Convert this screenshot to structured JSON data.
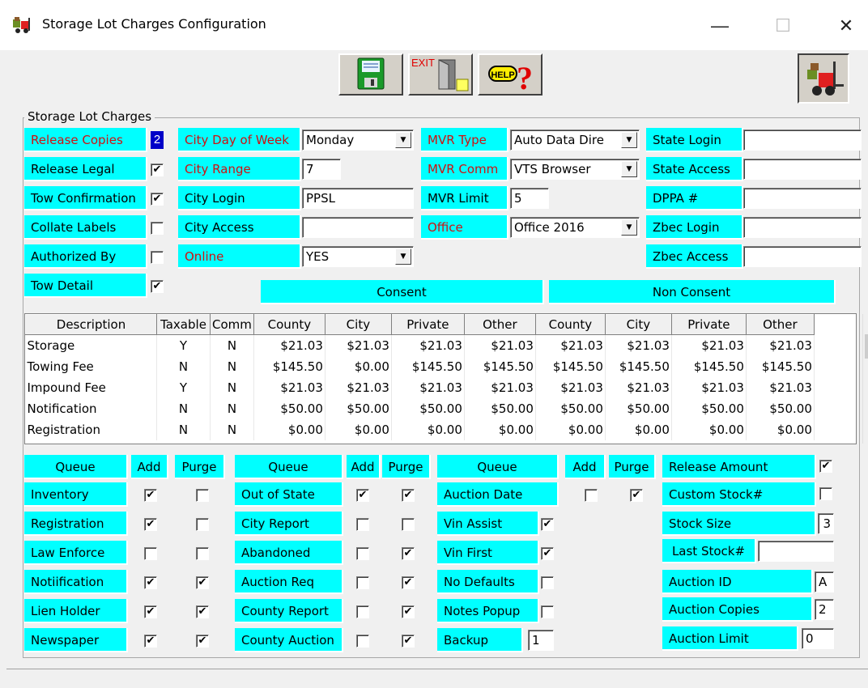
{
  "window": {
    "title": "Storage Lot Charges Configuration",
    "minimize_glyph": "—",
    "maximize_glyph": "☐",
    "close_glyph": "✕"
  },
  "toolbar": {
    "save_icon": "floppy-save-icon",
    "exit_label": "EXIT",
    "help_label": "HELP",
    "help_glyph": "?",
    "corner_icon": "forklift-icon"
  },
  "group_title": "Storage Lot Charges",
  "settings": {
    "release_copies": {
      "label": "Release Copies",
      "value": "2"
    },
    "release_legal": {
      "label": "Release Legal",
      "checked": true
    },
    "tow_confirmation": {
      "label": "Tow Confirmation",
      "checked": true
    },
    "collate_labels": {
      "label": "Collate Labels",
      "checked": false
    },
    "authorized_by": {
      "label": "Authorized By",
      "checked": false
    },
    "tow_detail": {
      "label": "Tow Detail",
      "checked": true
    },
    "city_day_of_week": {
      "label": "City Day of Week",
      "value": "Monday"
    },
    "city_range": {
      "label": "City Range",
      "value": "7"
    },
    "city_login": {
      "label": "City Login",
      "value": "PPSL"
    },
    "city_access": {
      "label": "City Access",
      "value": ""
    },
    "online": {
      "label": "Online",
      "value": "YES"
    },
    "mvr_type": {
      "label": "MVR Type",
      "value": "Auto Data Dire"
    },
    "mvr_comm": {
      "label": "MVR Comm",
      "value": "VTS Browser"
    },
    "mvr_limit": {
      "label": "MVR Limit",
      "value": "5"
    },
    "office": {
      "label": "Office",
      "value": "Office 2016"
    },
    "state_login": {
      "label": "State Login",
      "value": ""
    },
    "state_access": {
      "label": "State Access",
      "value": ""
    },
    "dppa": {
      "label": "DPPA #",
      "value": ""
    },
    "zbec_login": {
      "label": "Zbec Login",
      "value": ""
    },
    "zbec_access": {
      "label": "Zbec Access",
      "value": ""
    }
  },
  "consent_label": "Consent",
  "non_consent_label": "Non Consent",
  "grid": {
    "columns": [
      "Description",
      "Taxable",
      "Comm",
      "County",
      "City",
      "Private",
      "Other",
      "County",
      "City",
      "Private",
      "Other"
    ],
    "rows": [
      [
        "Storage",
        "Y",
        "N",
        "$21.03",
        "$21.03",
        "$21.03",
        "$21.03",
        "$21.03",
        "$21.03",
        "$21.03",
        "$21.03"
      ],
      [
        "Towing Fee",
        "N",
        "N",
        "$145.50",
        "$0.00",
        "$145.50",
        "$145.50",
        "$145.50",
        "$145.50",
        "$145.50",
        "$145.50"
      ],
      [
        "Impound Fee",
        "Y",
        "N",
        "$21.03",
        "$21.03",
        "$21.03",
        "$21.03",
        "$21.03",
        "$21.03",
        "$21.03",
        "$21.03"
      ],
      [
        "Notification",
        "N",
        "N",
        "$50.00",
        "$50.00",
        "$50.00",
        "$50.00",
        "$50.00",
        "$50.00",
        "$50.00",
        "$50.00"
      ],
      [
        "Registration",
        "N",
        "N",
        "$0.00",
        "$0.00",
        "$0.00",
        "$0.00",
        "$0.00",
        "$0.00",
        "$0.00",
        "$0.00"
      ]
    ]
  },
  "queue_header": {
    "queue": "Queue",
    "add": "Add",
    "purge": "Purge"
  },
  "queues1": [
    {
      "name": "Inventory",
      "add": true,
      "purge": false
    },
    {
      "name": "Registration",
      "add": true,
      "purge": false
    },
    {
      "name": "Law Enforce",
      "add": false,
      "purge": false
    },
    {
      "name": "Notiification",
      "add": true,
      "purge": true
    },
    {
      "name": "Lien Holder",
      "add": true,
      "purge": true
    },
    {
      "name": "Newspaper",
      "add": true,
      "purge": true
    }
  ],
  "queues2": [
    {
      "name": "Out of State",
      "add": true,
      "purge": true
    },
    {
      "name": "City Report",
      "add": false,
      "purge": false
    },
    {
      "name": "Abandoned",
      "add": false,
      "purge": true
    },
    {
      "name": "Auction Req",
      "add": false,
      "purge": true
    },
    {
      "name": "County Report",
      "add": false,
      "purge": true
    },
    {
      "name": "County Auction",
      "add": false,
      "purge": true
    }
  ],
  "queue3": {
    "name": "Auction Date",
    "add": false,
    "purge": true
  },
  "options3": [
    {
      "name": "Vin Assist",
      "checked": true
    },
    {
      "name": "Vin First",
      "checked": true
    },
    {
      "name": "No Defaults",
      "checked": false
    },
    {
      "name": "Notes Popup",
      "checked": false
    }
  ],
  "backup": {
    "label": "Backup",
    "value": "1"
  },
  "auction": {
    "release_amount": {
      "label": "Release Amount",
      "checked": true
    },
    "custom_stock": {
      "label": "Custom Stock#",
      "checked": false
    },
    "stock_size": {
      "label": "Stock Size",
      "value": "3"
    },
    "last_stock": {
      "label": "Last Stock#",
      "value": ""
    },
    "auction_id": {
      "label": "Auction ID",
      "value": "A"
    },
    "auction_copies": {
      "label": "Auction Copies",
      "value": "2"
    },
    "auction_limit": {
      "label": "Auction Limit",
      "value": "0"
    }
  }
}
